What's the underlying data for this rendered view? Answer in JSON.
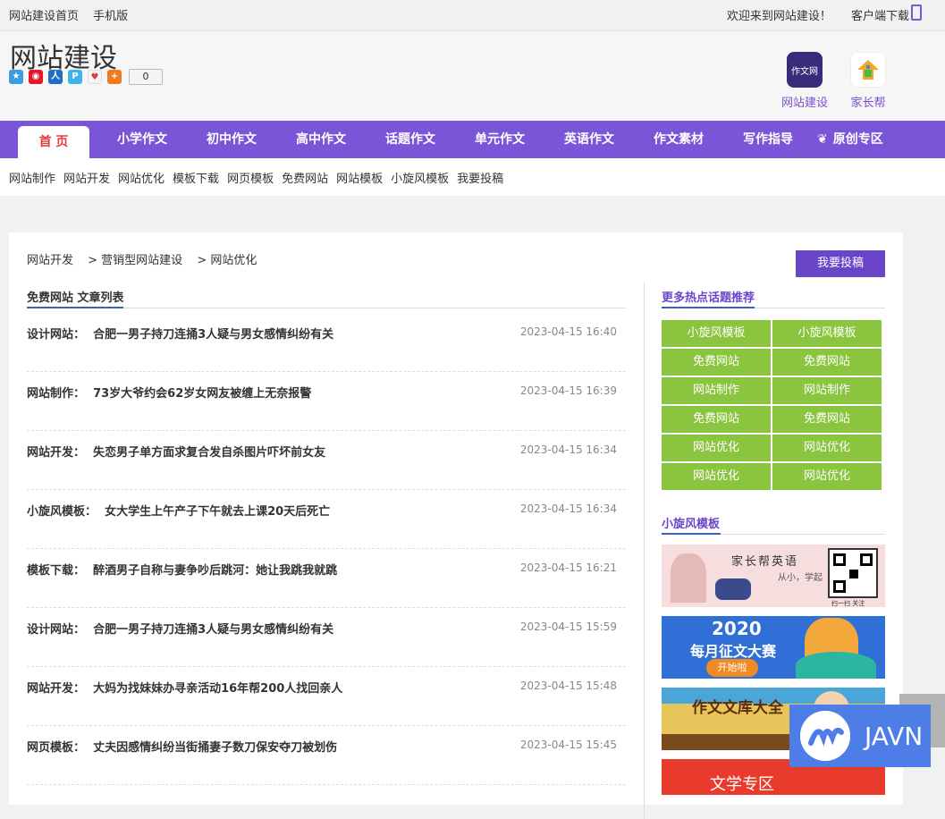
{
  "topbar": {
    "home_link": "网站建设首页",
    "mobile_link": "手机版",
    "welcome": "欢迎来到网站建设！",
    "client_download": "客户端下载"
  },
  "header": {
    "site_title": "网站建设",
    "share_count": "0",
    "apps": [
      {
        "label": "网站建设",
        "icon_text": "作文网"
      },
      {
        "label": "家长帮"
      }
    ]
  },
  "nav": {
    "items": [
      "首 页",
      "小学作文",
      "初中作文",
      "高中作文",
      "话题作文",
      "单元作文",
      "英语作文",
      "作文素材",
      "写作指导",
      "原创专区"
    ],
    "active_color": "#e8393c",
    "bg_color": "#7b55d8"
  },
  "subnav": [
    "网站制作",
    "网站开发",
    "网站优化",
    "模板下载",
    "网页模板",
    "免费网站",
    "网站模板",
    "小旋风模板",
    "我要投稿"
  ],
  "breadcrumb": [
    "网站开发",
    "> 营销型网站建设",
    "> 网站优化"
  ],
  "list_title": "免费网站 文章列表",
  "articles": [
    {
      "cat": "设计网站：",
      "title": "合肥一男子持刀连捅3人疑与男女感情纠纷有关",
      "time": "2023-04-15 16:40"
    },
    {
      "cat": "网站制作：",
      "title": "73岁大爷约会62岁女网友被缠上无奈报警",
      "time": "2023-04-15 16:39"
    },
    {
      "cat": "网站开发：",
      "title": "失恋男子单方面求复合发自杀图片吓坏前女友",
      "time": "2023-04-15 16:34"
    },
    {
      "cat": "小旋风模板：",
      "title": "女大学生上午产子下午就去上课20天后死亡",
      "time": "2023-04-15 16:34"
    },
    {
      "cat": "模板下载：",
      "title": "醉酒男子自称与妻争吵后跳河：她让我跳我就跳",
      "time": "2023-04-15 16:21"
    },
    {
      "cat": "设计网站：",
      "title": "合肥一男子持刀连捅3人疑与男女感情纠纷有关",
      "time": "2023-04-15 15:59"
    },
    {
      "cat": "网站开发：",
      "title": "大妈为找妹妹办寻亲活动16年帮200人找回亲人",
      "time": "2023-04-15 15:48"
    },
    {
      "cat": "网页模板：",
      "title": "丈夫因感情纠纷当街捅妻子数刀保安夺刀被划伤",
      "time": "2023-04-15 15:45"
    }
  ],
  "sidebar": {
    "submit_button": "我要投稿",
    "hot_title": "更多热点话题推荐",
    "tags": [
      "小旋风模板",
      "小旋风模板",
      "免费网站",
      "免费网站",
      "网站制作",
      "网站制作",
      "免费网站",
      "免费网站",
      "网站优化",
      "网站优化",
      "网站优化",
      "网站优化"
    ],
    "tag_color": "#8bc53f",
    "section2_title": "小旋风模板",
    "banners": [
      {
        "text": "家长帮英语",
        "sub": "从小，学起",
        "caption": "扫一扫 关注"
      },
      {
        "text": "2020",
        "sub": "每月征文大赛",
        "caption": "开始啦"
      },
      {
        "text": "作文文库大全"
      },
      {
        "text": "文学专区"
      }
    ]
  },
  "float_badge": {
    "text": "JAVN"
  }
}
